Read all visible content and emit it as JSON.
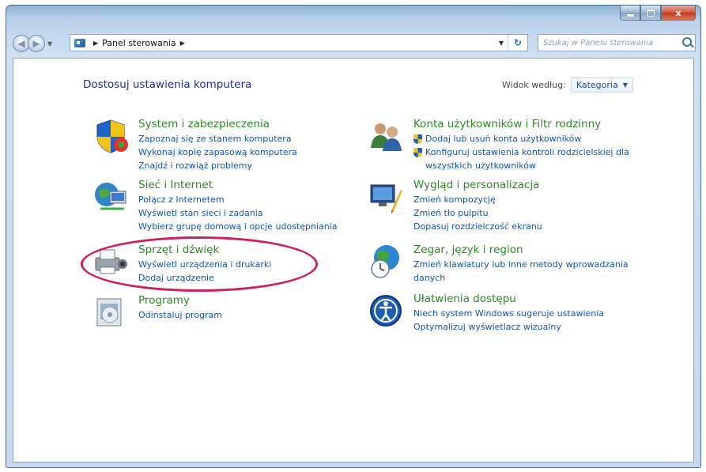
{
  "window": {
    "address": {
      "root_label": "Panel sterowania"
    },
    "search": {
      "placeholder": "Szukaj w Panelu sterowania"
    },
    "caption": {
      "close_label": "x"
    }
  },
  "main": {
    "heading": "Dostosuj ustawienia komputera",
    "view_by": {
      "label": "Widok według:",
      "value": "Kategoria"
    }
  },
  "categories_left": [
    {
      "title": "System i zabezpieczenia",
      "icon": "shield-flag-icon",
      "links": [
        "Zapoznaj się ze stanem komputera",
        "Wykonaj kopię zapasową komputera",
        "Znajdź i rozwiąż problemy"
      ]
    },
    {
      "title": "Sieć i Internet",
      "icon": "network-globe-icon",
      "links": [
        "Połącz z Internetem",
        "Wyświetl stan sieci i zadania",
        "Wybierz grupę domową i opcje udostępniania"
      ]
    },
    {
      "title": "Sprzęt i dźwięk",
      "icon": "printer-speaker-icon",
      "links": [
        "Wyświetl urządzenia i drukarki",
        "Dodaj urządzenie"
      ]
    },
    {
      "title": "Programy",
      "icon": "programs-box-icon",
      "links": [
        "Odinstaluj program"
      ]
    }
  ],
  "categories_right": [
    {
      "title": "Konta użytkowników i Filtr rodzinny",
      "icon": "users-icon",
      "links": [
        "Dodaj lub usuń konta użytkowników",
        "Konfiguruj ustawienia kontroli rodzicielskiej dla",
        "wszystkich użytkowników"
      ]
    },
    {
      "title": "Wygląd i personalizacja",
      "icon": "monitor-paint-icon",
      "links": [
        "Zmień kompozycję",
        "Zmień tło pulpitu",
        "Dopasuj rozdzielczość ekranu"
      ]
    },
    {
      "title": "Zegar, język i region",
      "icon": "clock-globe-icon",
      "links": [
        "Zmień klawiatury lub inne metody wprowadzania",
        "danych"
      ]
    },
    {
      "title": "Ułatwienia dostępu",
      "icon": "accessibility-icon",
      "links": [
        "Niech system Windows sugeruje ustawienia",
        "Optymalizuj wyświetlacz wizualny"
      ]
    }
  ],
  "colors": {
    "title_green": "#2b8a24",
    "link_blue": "#0d56b5",
    "heading_blue": "#1e3287",
    "highlight": "#d0205a"
  }
}
